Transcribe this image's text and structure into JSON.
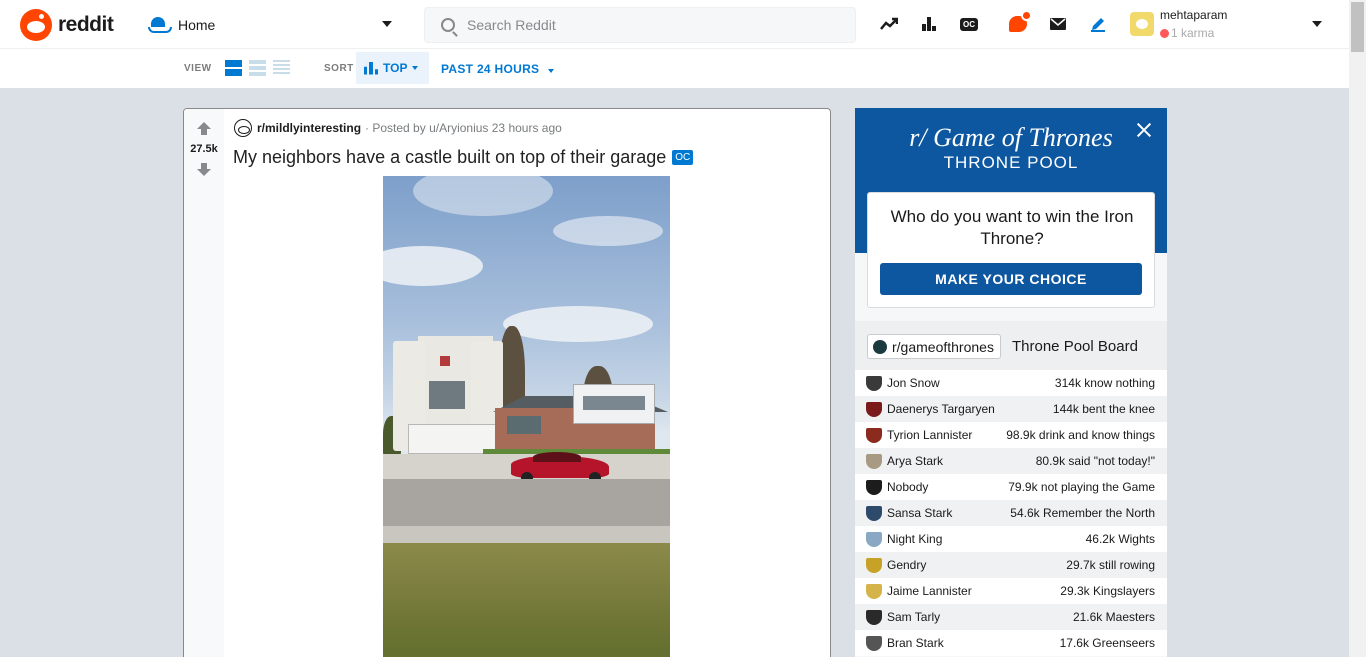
{
  "header": {
    "logo_text": "reddit",
    "home_label": "Home",
    "search_placeholder": "Search Reddit",
    "username": "mehtaparam",
    "karma": "1 karma"
  },
  "sortbar": {
    "view_label": "VIEW",
    "sort_label": "SORT",
    "sort_value": "TOP",
    "time_value": "PAST 24 HOURS"
  },
  "post": {
    "score": "27.5k",
    "subreddit": "r/mildlyinteresting",
    "meta": "· Posted by u/Aryionius 23 hours ago",
    "title": "My neighbors have a castle built on top of their garage",
    "flair": "OC"
  },
  "sidebar": {
    "logo": "r/ Game of Thrones",
    "subtitle": "THRONE POOL",
    "question": "Who do you want to win the Iron Throne?",
    "cta": "MAKE YOUR CHOICE",
    "board_sub": "r/gameofthrones",
    "board_title": "Throne Pool Board",
    "rows": [
      {
        "name": "Jon Snow",
        "value": "314k know nothing",
        "color": "#3a3a3a"
      },
      {
        "name": "Daenerys Targaryen",
        "value": "144k bent the knee",
        "color": "#7a1a1a"
      },
      {
        "name": "Tyrion Lannister",
        "value": "98.9k drink and know things",
        "color": "#8b2a1f"
      },
      {
        "name": "Arya Stark",
        "value": "80.9k said \"not today!\"",
        "color": "#a89a82"
      },
      {
        "name": "Nobody",
        "value": "79.9k not playing the Game",
        "color": "#1c1c1c"
      },
      {
        "name": "Sansa Stark",
        "value": "54.6k Remember the North",
        "color": "#2d4a6b"
      },
      {
        "name": "Night King",
        "value": "46.2k Wights",
        "color": "#8aa7c4"
      },
      {
        "name": "Gendry",
        "value": "29.7k still rowing",
        "color": "#c8a227"
      },
      {
        "name": "Jaime Lannister",
        "value": "29.3k Kingslayers",
        "color": "#d4b44a"
      },
      {
        "name": "Sam Tarly",
        "value": "21.6k Maesters",
        "color": "#2a2a2a"
      },
      {
        "name": "Bran Stark",
        "value": "17.6k Greenseers",
        "color": "#555555"
      }
    ]
  }
}
